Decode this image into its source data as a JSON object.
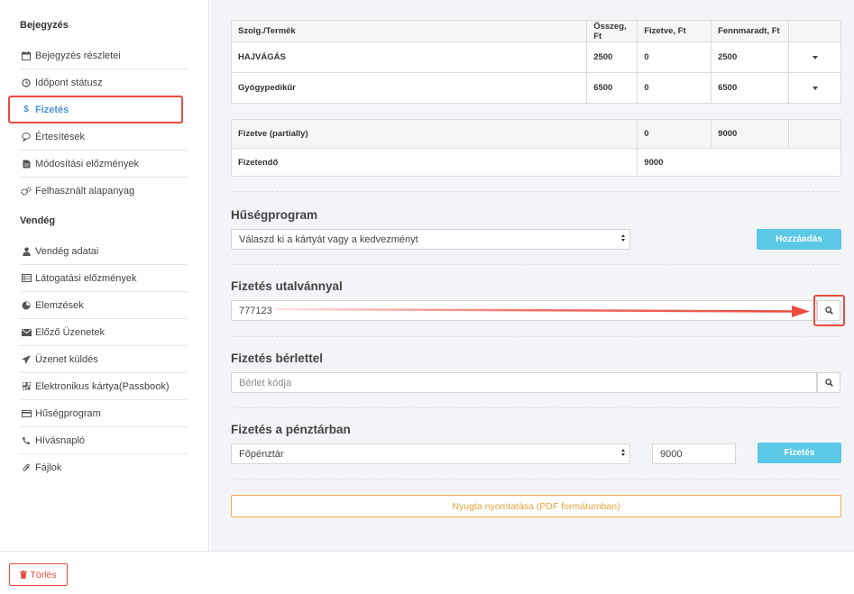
{
  "sidebar": {
    "section1": "Bejegyzés",
    "items1": [
      {
        "label": "Bejegyzés részletei",
        "icon": "calendar-icon"
      },
      {
        "label": "Időpont státusz",
        "icon": "clock-icon"
      },
      {
        "label": "Fizetés",
        "icon": "dollar-icon"
      },
      {
        "label": "Értesítések",
        "icon": "chat-icon"
      },
      {
        "label": "Módosítási előzmények",
        "icon": "document-icon"
      },
      {
        "label": "Felhasznált alapanyag",
        "icon": "gears-icon"
      }
    ],
    "section2": "Vendég",
    "items2": [
      {
        "label": "Vendég adatai",
        "icon": "user-icon"
      },
      {
        "label": "Látogatási előzmények",
        "icon": "list-icon"
      },
      {
        "label": "Elemzések",
        "icon": "pie-icon"
      },
      {
        "label": "Előző Üzenetek",
        "icon": "envelope-icon"
      },
      {
        "label": "Üzenet küldés",
        "icon": "paper-plane-icon"
      },
      {
        "label": "Elektronikus kártya(Passbook)",
        "icon": "qr-icon"
      },
      {
        "label": "Hűségprogram",
        "icon": "card-icon"
      },
      {
        "label": "Hívásnapló",
        "icon": "phone-icon"
      },
      {
        "label": "Fájlok",
        "icon": "paperclip-icon"
      }
    ]
  },
  "services_table": {
    "headers": [
      "Szolg./Termék",
      "Összeg, Ft",
      "Fizetve, Ft",
      "Fennmaradt, Ft"
    ],
    "rows": [
      {
        "name": "HAJVÁGÁS",
        "amount": "2500",
        "paid": "0",
        "remaining": "2500"
      },
      {
        "name": "Gyógypedikűr",
        "amount": "6500",
        "paid": "0",
        "remaining": "6500"
      }
    ]
  },
  "summary_table": {
    "paid_label": "Fizetve (partially)",
    "paid_value": "0",
    "paid_remaining": "9000",
    "due_label": "Fizetendő",
    "due_value": "9000"
  },
  "loyalty": {
    "title": "Hűségprogram",
    "select_value": "Válaszd ki a kártyát vagy a kedvezményt",
    "button": "Hozzáadás"
  },
  "voucher": {
    "title": "Fizetés utalvánnyal",
    "value": "777123"
  },
  "pass": {
    "title": "Fizetés bérlettel",
    "placeholder": "Bérlet kódja"
  },
  "cashier": {
    "title": "Fizetés a pénztárban",
    "select_value": "Főpénztár",
    "amount": "9000",
    "button": "Fizetés"
  },
  "print_button": "Nyugta nyomtatása (PDF formátumban)",
  "delete_button": "Törlés",
  "colors": {
    "accent": "#4a90d9",
    "highlight": "#e84c3d",
    "button_blue": "#5bc8e6",
    "print_orange": "#f0ad4e"
  }
}
